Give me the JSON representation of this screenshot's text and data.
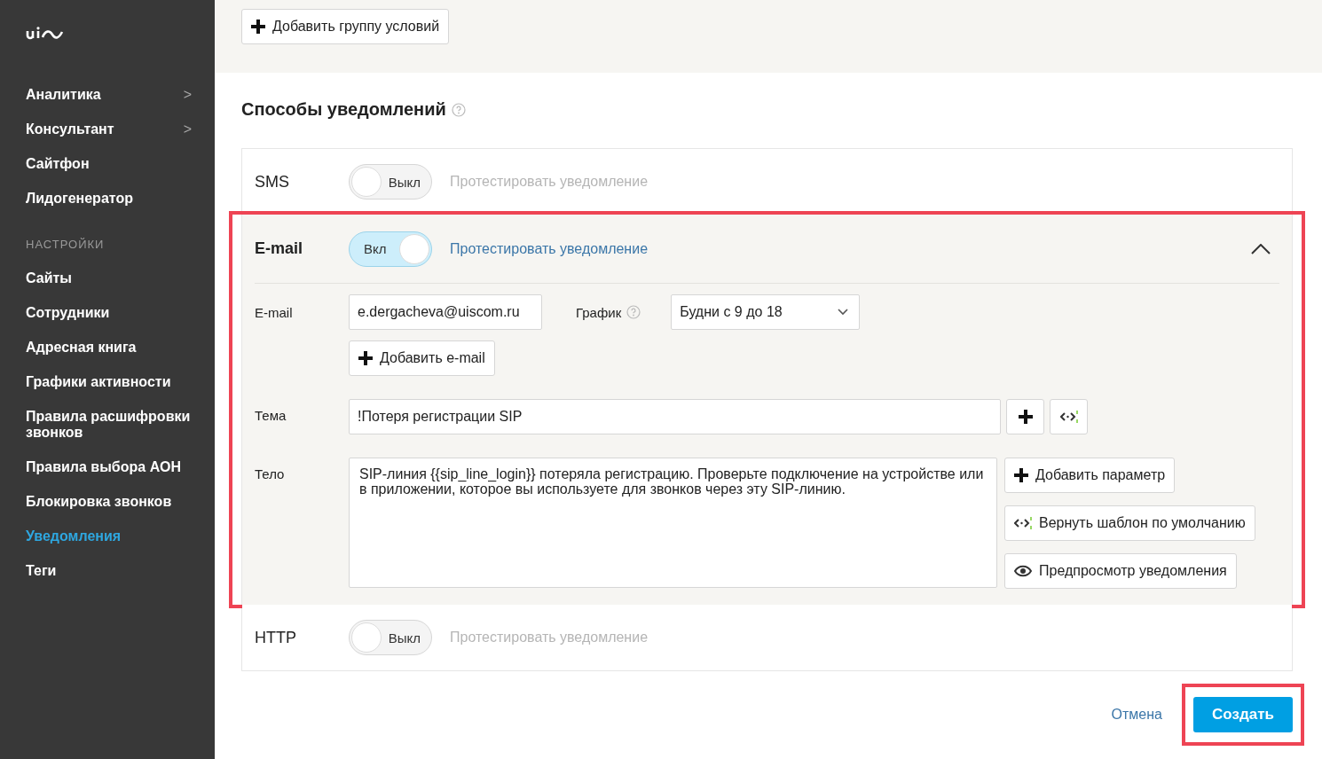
{
  "sidebar": {
    "items": [
      {
        "label": "Аналитика",
        "arrow": ">",
        "selected": false
      },
      {
        "label": "Консультант",
        "arrow": ">",
        "selected": false
      },
      {
        "label": "Сайтфон",
        "selected": false
      },
      {
        "label": "Лидогенератор",
        "selected": false
      }
    ],
    "section_label": "НАСТРОЙКИ",
    "settings_items": [
      {
        "label": "Сайты",
        "selected": false
      },
      {
        "label": "Сотрудники",
        "selected": false
      },
      {
        "label": "Адресная книга",
        "selected": false
      },
      {
        "label": "Графики активности",
        "selected": false
      },
      {
        "label": "Правила расшифровки звонков",
        "selected": false
      },
      {
        "label": "Правила выбора АОН",
        "selected": false
      },
      {
        "label": "Блокировка звонков",
        "selected": false
      },
      {
        "label": "Уведомления",
        "selected": true
      },
      {
        "label": "Теги",
        "selected": false
      }
    ]
  },
  "top": {
    "add_group_button": "Добавить группу условий"
  },
  "notifications": {
    "title": "Способы уведомлений",
    "channels": [
      {
        "name": "SMS",
        "on": false,
        "toggle_label": "Выкл",
        "test_link": "Протестировать уведомление",
        "expanded": false,
        "highlighted": false
      },
      {
        "name": "E-mail",
        "on": true,
        "toggle_label": "Вкл",
        "test_link": "Протестировать уведомление",
        "expanded": true,
        "highlighted": true
      },
      {
        "name": "HTTP",
        "on": false,
        "toggle_label": "Выкл",
        "test_link": "Протестировать уведомление",
        "expanded": false,
        "highlighted": false
      }
    ]
  },
  "email_form": {
    "email_label": "E-mail",
    "email_value": "e.dergacheva@uiscom.ru",
    "schedule_label": "График",
    "schedule_value": "Будни с 9 до 18",
    "add_email_button": "Добавить e-mail",
    "subject_label": "Тема",
    "subject_value": "!Потеря регистрации SIP",
    "body_label": "Тело",
    "body_value": "SIP-линия {{sip_line_login}} потеряла регистрацию. Проверьте подключение на устройстве или в приложении, которое вы используете для звонков через эту SIP-линию.",
    "add_parameter_button": "Добавить параметр",
    "reset_template_button": "Вернуть шаблон по умолчанию",
    "preview_button": "Предпросмотр уведомления"
  },
  "footer": {
    "cancel": "Отмена",
    "create": "Создать",
    "create_highlighted": true
  }
}
